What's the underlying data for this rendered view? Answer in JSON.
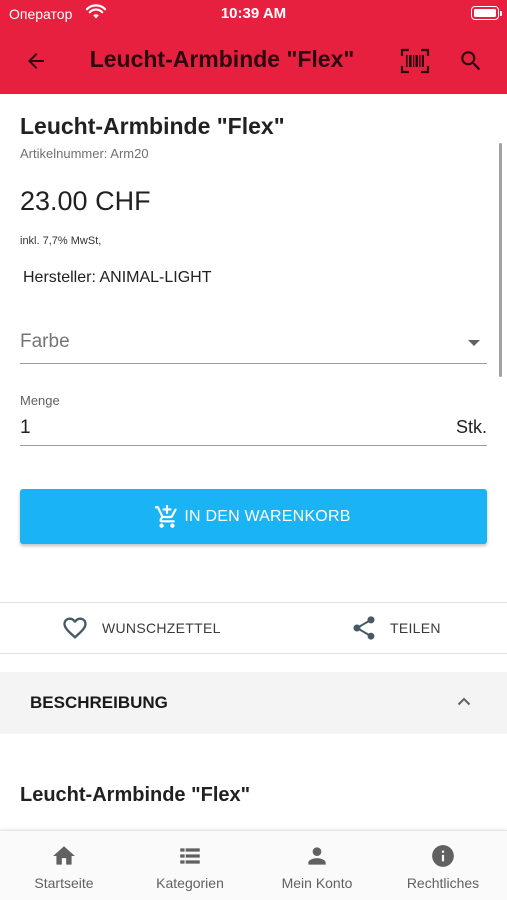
{
  "status_bar": {
    "carrier": "Оператор",
    "time": "10:39 AM"
  },
  "app_bar": {
    "title": "Leucht-Armbinde \"Flex\"",
    "icons": {
      "back": "arrow-left-icon",
      "scan": "barcode-scan-icon",
      "search": "search-icon"
    }
  },
  "product": {
    "title": "Leucht-Armbinde \"Flex\"",
    "sku": "Artikelnummer: Arm20",
    "price": "23.00 CHF",
    "vat": "inkl. 7,7% MwSt,",
    "manufacturer": "Hersteller: ANIMAL-LIGHT"
  },
  "options": {
    "color_placeholder": "Farbe",
    "quantity_label": "Menge",
    "quantity_value": "1",
    "quantity_unit": "Stk."
  },
  "cart_button": {
    "label": "IN DEN WARENKORB",
    "icon": "cart-plus-icon"
  },
  "actions": {
    "wishlist": {
      "label": "WUNSCHZETTEL",
      "icon": "heart-outline-icon"
    },
    "share": {
      "label": "TEILEN",
      "icon": "share-icon"
    }
  },
  "description": {
    "section_title": "BESCHREIBUNG",
    "expanded": true,
    "heading": "Leucht-Armbinde \"Flex\""
  },
  "bottom_nav": [
    {
      "label": "Startseite",
      "icon": "home-icon"
    },
    {
      "label": "Kategorien",
      "icon": "list-icon"
    },
    {
      "label": "Mein Konto",
      "icon": "person-icon"
    },
    {
      "label": "Rechtliches",
      "icon": "info-icon"
    }
  ],
  "colors": {
    "app_bar": "#e8203f",
    "cart_button": "#1ab4f5",
    "accordion_bg": "#f4f4f4"
  }
}
